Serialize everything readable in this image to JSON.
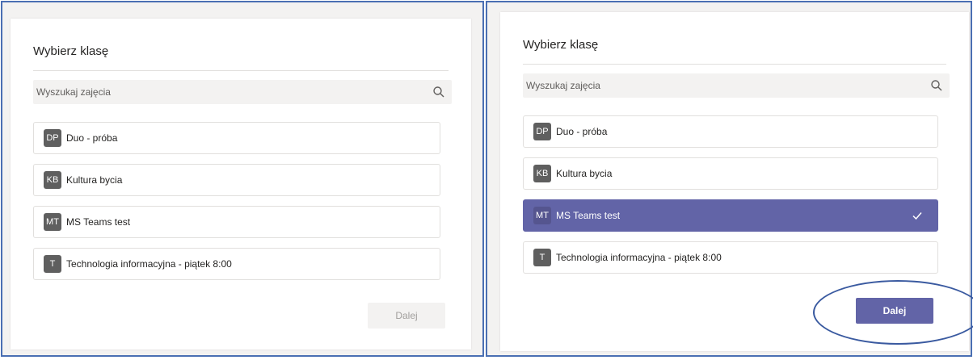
{
  "colors": {
    "accent": "#6264a7",
    "frame_border": "#4a6fb3",
    "disabled_button_bg": "#f3f2f1",
    "disabled_button_text": "#a19f9d"
  },
  "left_panel": {
    "title": "Wybierz klasę",
    "search": {
      "placeholder": "Wyszukaj zajęcia",
      "value": "",
      "icon": "search-icon"
    },
    "classes": [
      {
        "initials": "DP",
        "name": "Duo - próba",
        "selected": false
      },
      {
        "initials": "KB",
        "name": "Kultura bycia",
        "selected": false
      },
      {
        "initials": "MT",
        "name": "MS Teams test",
        "selected": false
      },
      {
        "initials": "T",
        "name": "Technologia informacyjna - piątek 8:00",
        "selected": false
      }
    ],
    "next_button": {
      "label": "Dalej",
      "enabled": false
    }
  },
  "right_panel": {
    "title": "Wybierz klasę",
    "search": {
      "placeholder": "Wyszukaj zajęcia",
      "value": "",
      "icon": "search-icon"
    },
    "classes": [
      {
        "initials": "DP",
        "name": "Duo - próba",
        "selected": false
      },
      {
        "initials": "KB",
        "name": "Kultura bycia",
        "selected": false
      },
      {
        "initials": "MT",
        "name": "MS Teams test",
        "selected": true,
        "icon": "check-icon"
      },
      {
        "initials": "T",
        "name": "Technologia informacyjna - piątek 8:00",
        "selected": false
      }
    ],
    "next_button": {
      "label": "Dalej",
      "enabled": true
    }
  }
}
